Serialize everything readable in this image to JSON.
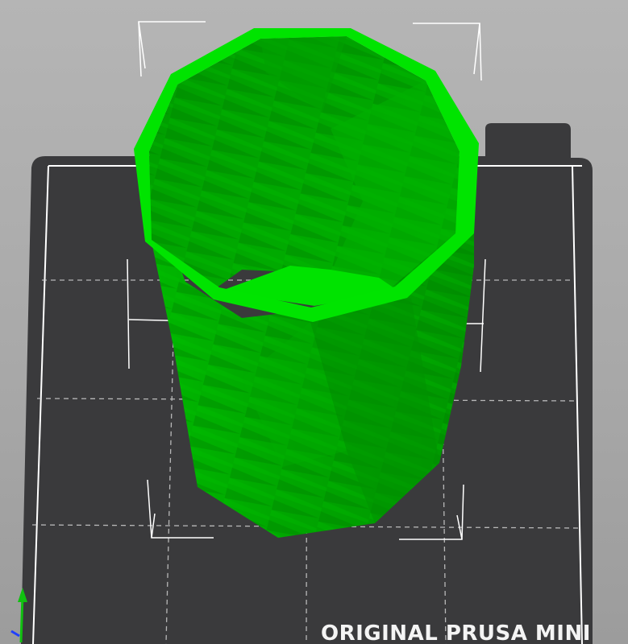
{
  "viewport": {
    "bed_label": "ORIGINAL PRUSA MINI",
    "colors": {
      "background_top": "#b5b5b5",
      "background_bottom": "#9c9c9c",
      "bed": "#3a3a3c",
      "bed_border": "#ffffff",
      "grid_lines": "#d8d8d8",
      "model_light": "#00e400",
      "model_mid": "#00b400",
      "model_dark": "#008f00",
      "bounding_box": "#ffffff",
      "axis_y": "#10c010",
      "axis_x": "#2040ff"
    },
    "icons": [
      "axis-gizmo-icon"
    ]
  }
}
